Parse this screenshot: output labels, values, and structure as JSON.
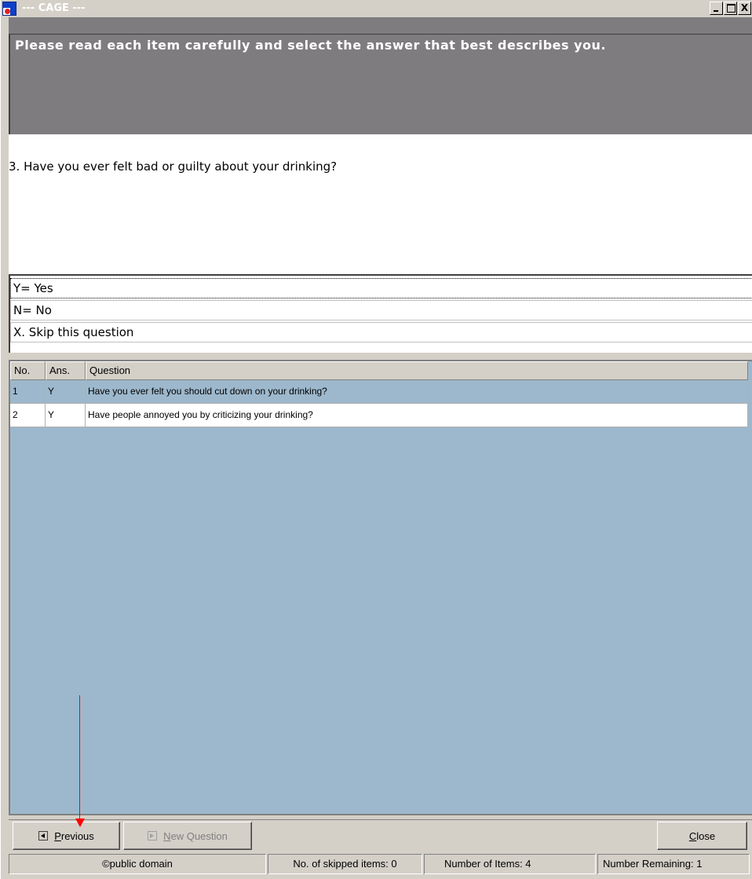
{
  "window": {
    "title": "--- CAGE ---",
    "controls": [
      "_",
      "□",
      "X"
    ]
  },
  "instruction": "Please read each item carefully and select the answer that best describes you.",
  "question": "3.  Have you ever felt bad or guilty about your drinking?",
  "answers": [
    {
      "label": "Y= Yes",
      "selected": true
    },
    {
      "label": "N= No",
      "selected": false
    },
    {
      "label": "X. Skip this question",
      "selected": false
    }
  ],
  "grid": {
    "headers": [
      "No.",
      "Ans.",
      "Question"
    ],
    "rows": [
      {
        "no": "1",
        "ans": "Y",
        "question": "Have you ever felt you should cut down on your drinking?"
      },
      {
        "no": "2",
        "ans": "Y",
        "question": "Have people annoyed you by criticizing your drinking?"
      }
    ]
  },
  "buttons": {
    "previous": {
      "accel": "P",
      "rest": "revious"
    },
    "new_question": {
      "accel": "N",
      "rest": "ew Question"
    },
    "close": {
      "accel": "C",
      "rest": "lose"
    }
  },
  "status": {
    "copyright": "©public domain",
    "skipped": "No. of skipped items: 0",
    "items": "Number of Items:  4",
    "remaining": "Number Remaining:  1"
  },
  "colors": {
    "instruction_bg": "#7f7c80",
    "grid_bg": "#9db8cc",
    "annotation_arrow": "#ff0000"
  }
}
